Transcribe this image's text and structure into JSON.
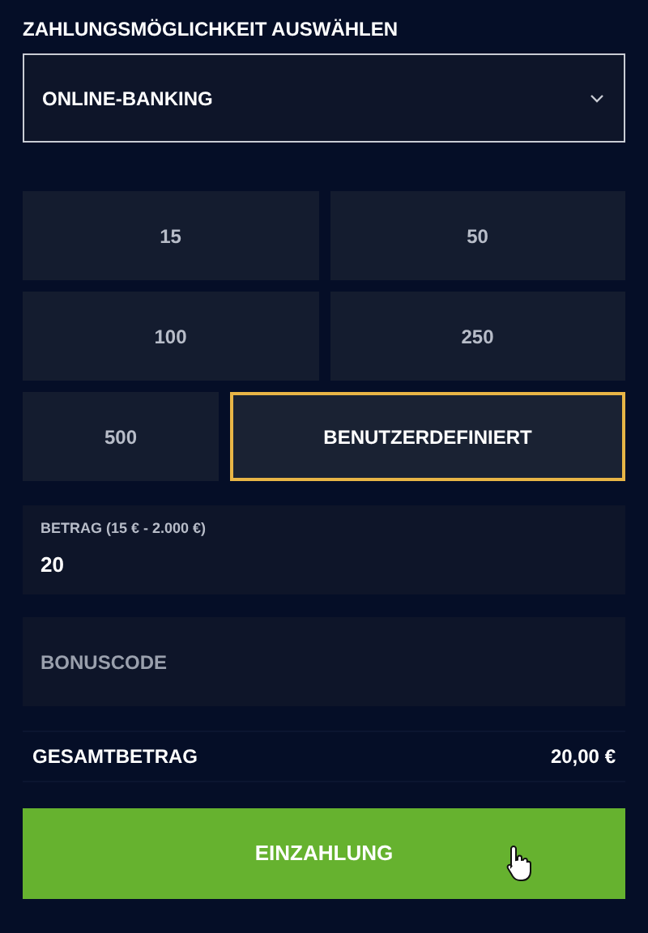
{
  "heading": "ZAHLUNGSMÖGLICHKEIT AUSWÄHLEN",
  "payment_select": {
    "value": "ONLINE-BANKING"
  },
  "amounts": [
    {
      "label": "15",
      "selected": false
    },
    {
      "label": "50",
      "selected": false
    },
    {
      "label": "100",
      "selected": false
    },
    {
      "label": "250",
      "selected": false
    },
    {
      "label": "500",
      "selected": false
    },
    {
      "label": "BENUTZERDEFINIERT",
      "selected": true
    }
  ],
  "amount_field": {
    "label": "BETRAG (15 € - 2.000 €)",
    "value": "20"
  },
  "bonus_field": {
    "placeholder": "BONUSCODE"
  },
  "total": {
    "label": "GESAMTBETRAG",
    "value": "20,00 €"
  },
  "submit_button": "EINZAHLUNG"
}
